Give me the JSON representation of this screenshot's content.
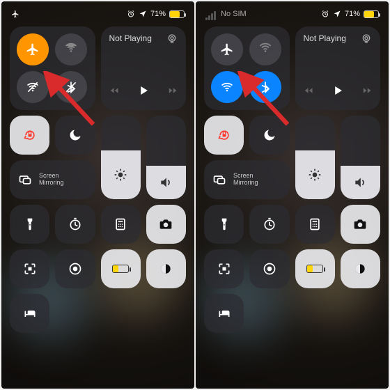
{
  "left": {
    "status": {
      "airplane_mode": true,
      "carrier": "",
      "alarm": true,
      "location": true,
      "battery_pct": "71%",
      "battery_fill": 71
    },
    "connectivity": {
      "airplane_on": true,
      "cellular_on": false,
      "wifi_on": false,
      "bluetooth_on": false
    },
    "media": {
      "title": "Not Playing"
    },
    "screen_mirroring_label": "Screen\nMirroring",
    "brightness_pct": 58,
    "volume_pct": 40,
    "rotation_locked": true,
    "focus_on": false
  },
  "right": {
    "status": {
      "airplane_mode": false,
      "carrier": "No SIM",
      "alarm": true,
      "location": true,
      "battery_pct": "71%",
      "battery_fill": 71
    },
    "connectivity": {
      "airplane_on": false,
      "cellular_on": false,
      "wifi_on": true,
      "bluetooth_on": true
    },
    "media": {
      "title": "Not Playing"
    },
    "screen_mirroring_label": "Screen\nMirroring",
    "brightness_pct": 58,
    "volume_pct": 40,
    "rotation_locked": true,
    "focus_on": false
  },
  "icons": {
    "airplane": "airplane-icon",
    "cellular": "cellular-icon",
    "wifi": "wifi-icon",
    "bluetooth": "bluetooth-icon",
    "airplay": "airplay-icon",
    "play": "play-icon",
    "rewind": "rewind-icon",
    "forward": "forward-icon",
    "rotation_lock": "rotation-lock-icon",
    "moon": "moon-icon",
    "screen_mirror": "screen-mirroring-icon",
    "brightness": "sun-icon",
    "volume": "speaker-icon",
    "flashlight": "flashlight-icon",
    "timer": "timer-icon",
    "calculator": "calculator-icon",
    "camera": "camera-icon",
    "qr": "qr-scan-icon",
    "record": "screen-record-icon",
    "lowpower": "low-power-icon",
    "darkmode": "dark-mode-icon",
    "bed": "sleep-icon"
  },
  "colors": {
    "orange": "#ff9500",
    "blue": "#0a84ff",
    "red": "#ff3b30",
    "yellow": "#ffd60a"
  }
}
